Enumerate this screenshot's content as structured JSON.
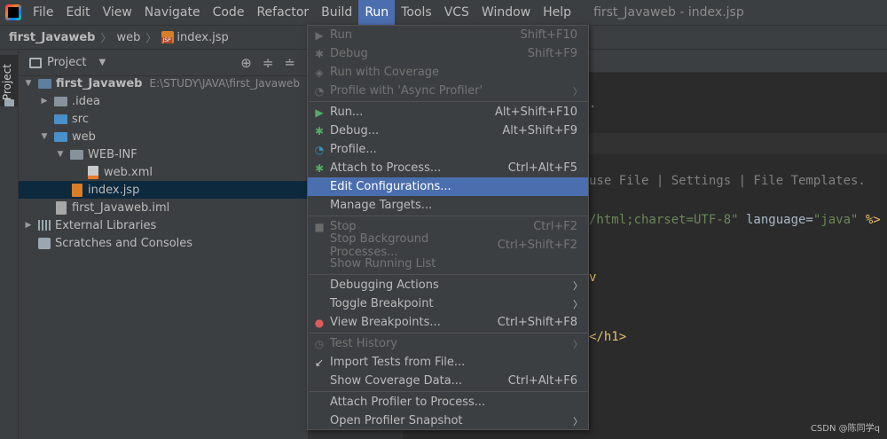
{
  "menubar": {
    "items": [
      "File",
      "Edit",
      "View",
      "Navigate",
      "Code",
      "Refactor",
      "Build",
      "Run",
      "Tools",
      "VCS",
      "Window",
      "Help"
    ],
    "window_title": "first_Javaweb - index.jsp"
  },
  "breadcrumb": {
    "project": "first_Javaweb",
    "folder": "web",
    "file": "index.jsp"
  },
  "sidebar": {
    "tab_label": "Project"
  },
  "project_panel": {
    "title": "Project",
    "tree": [
      {
        "label": "first_Javaweb",
        "path": "E:\\STUDY\\JAVA\\first_Javaweb"
      },
      {
        "label": ".idea"
      },
      {
        "label": "src"
      },
      {
        "label": "web"
      },
      {
        "label": "WEB-INF"
      },
      {
        "label": "web.xml"
      },
      {
        "label": "index.jsp"
      },
      {
        "label": "first_Javaweb.iml"
      },
      {
        "label": "External Libraries"
      },
      {
        "label": "Scratches and Consoles"
      }
    ]
  },
  "editor": {
    "line1": "use File | Settings | File Templates.",
    "line2_a": "/html;charset=UTF-8\"",
    "line2_b": " language=",
    "line2_c": "\"java\"",
    "line2_d": " %>",
    "line3": "</h1>",
    "frag_dots": ".",
    "frag_v": "v"
  },
  "run_menu": {
    "items": [
      {
        "label": "Run",
        "shortcut": "Shift+F10"
      },
      {
        "label": "Debug",
        "shortcut": "Shift+F9"
      },
      {
        "label": "Run with Coverage",
        "shortcut": ""
      },
      {
        "label": "Profile with 'Async Profiler'",
        "shortcut": ""
      },
      {
        "label": "Run...",
        "shortcut": "Alt+Shift+F10"
      },
      {
        "label": "Debug...",
        "shortcut": "Alt+Shift+F9"
      },
      {
        "label": "Profile...",
        "shortcut": ""
      },
      {
        "label": "Attach to Process...",
        "shortcut": "Ctrl+Alt+F5"
      },
      {
        "label": "Edit Configurations...",
        "shortcut": ""
      },
      {
        "label": "Manage Targets...",
        "shortcut": ""
      },
      {
        "label": "Stop",
        "shortcut": "Ctrl+F2"
      },
      {
        "label": "Stop Background Processes...",
        "shortcut": "Ctrl+Shift+F2"
      },
      {
        "label": "Show Running List",
        "shortcut": ""
      },
      {
        "label": "Debugging Actions",
        "shortcut": ""
      },
      {
        "label": "Toggle Breakpoint",
        "shortcut": ""
      },
      {
        "label": "View Breakpoints...",
        "shortcut": "Ctrl+Shift+F8"
      },
      {
        "label": "Test History",
        "shortcut": ""
      },
      {
        "label": "Import Tests from File...",
        "shortcut": ""
      },
      {
        "label": "Show Coverage Data...",
        "shortcut": "Ctrl+Alt+F6"
      },
      {
        "label": "Attach Profiler to Process...",
        "shortcut": ""
      },
      {
        "label": "Open Profiler Snapshot",
        "shortcut": ""
      }
    ]
  },
  "watermark": "CSDN @陈同学q",
  "colors": {
    "accent": "#4b6eaf",
    "background": "#2b2b2b",
    "panel": "#3c3f41"
  }
}
